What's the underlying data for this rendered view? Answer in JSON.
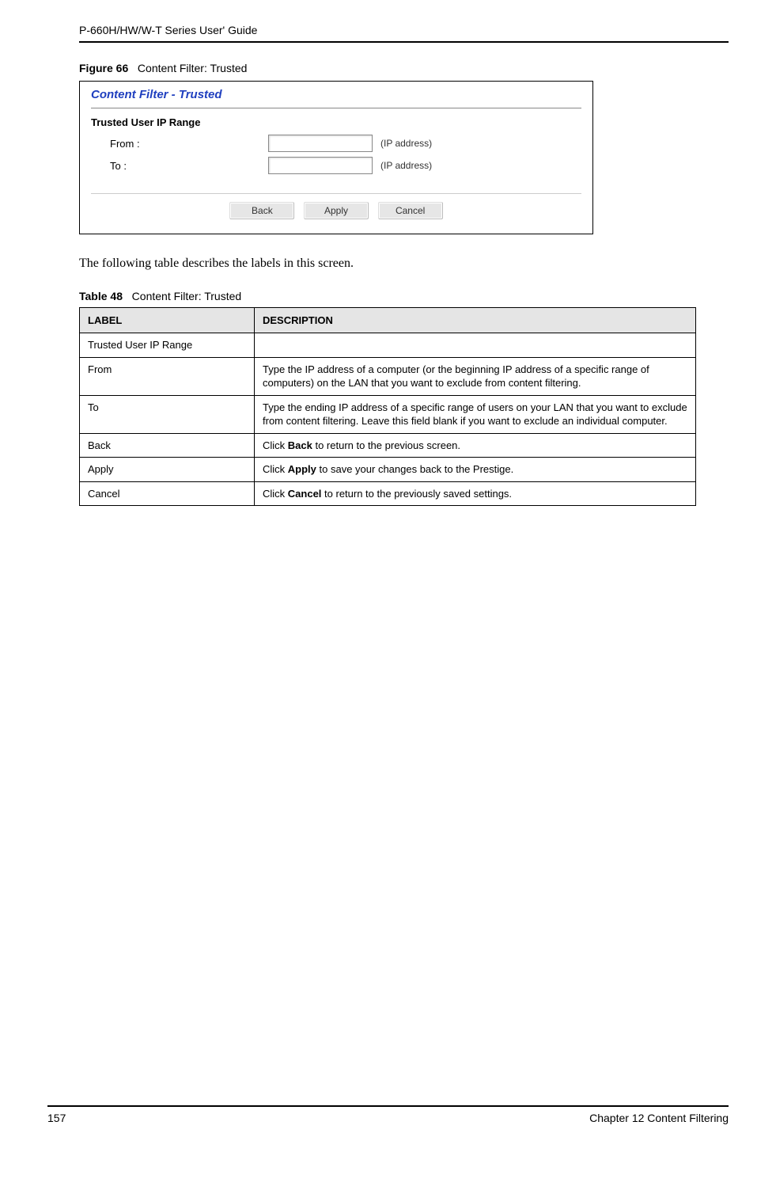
{
  "header": {
    "running": "P-660H/HW/W-T Series User' Guide"
  },
  "figure": {
    "label": "Figure 66",
    "title": "Content Filter: Trusted"
  },
  "screenshot": {
    "panel_title": "Content Filter - Trusted",
    "section_heading": "Trusted User IP Range",
    "from_label": "From :",
    "to_label": "To :",
    "ip_hint": "(IP address)",
    "buttons": {
      "back": "Back",
      "apply": "Apply",
      "cancel": "Cancel"
    }
  },
  "paragraph": "The following table describes the labels in this screen.",
  "table": {
    "caption_label": "Table 48",
    "caption_title": "Content Filter: Trusted",
    "head": {
      "label": "LABEL",
      "desc": "DESCRIPTION"
    },
    "rows": [
      {
        "label": "Trusted User IP Range",
        "desc": ""
      },
      {
        "label": "From",
        "desc": "Type the IP address of a computer (or the beginning IP address of a specific range of computers) on the LAN that you want to exclude from content filtering."
      },
      {
        "label": "To",
        "desc": "Type the ending IP address of a specific range of users on your LAN that you want to exclude from content filtering. Leave this field blank if you want to exclude an individual computer."
      },
      {
        "label": "Back",
        "desc_pre": "Click ",
        "desc_bold": "Back",
        "desc_post": " to return to the previous screen."
      },
      {
        "label": "Apply",
        "desc_pre": "Click ",
        "desc_bold": "Apply",
        "desc_post": " to save your changes back to the Prestige."
      },
      {
        "label": "Cancel",
        "desc_pre": "Click ",
        "desc_bold": "Cancel",
        "desc_post": " to return to the previously saved settings."
      }
    ]
  },
  "footer": {
    "page": "157",
    "chapter": "Chapter 12 Content Filtering"
  }
}
